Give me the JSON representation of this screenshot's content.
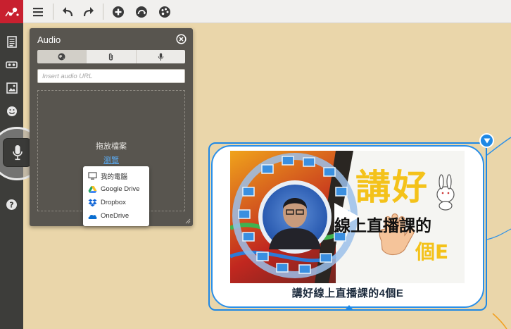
{
  "toolbar": {
    "logo": "mindomo-logo",
    "buttons": [
      {
        "name": "menu-button",
        "icon": "hamburger-icon"
      },
      {
        "name": "undo-button",
        "icon": "undo-icon"
      },
      {
        "name": "redo-button",
        "icon": "redo-icon"
      },
      {
        "name": "add-topic-button",
        "icon": "plus-circle-icon"
      },
      {
        "name": "relationship-button",
        "icon": "curve-arrow-icon"
      },
      {
        "name": "theme-button",
        "icon": "palette-icon"
      }
    ]
  },
  "sidebar": {
    "items": [
      {
        "name": "notes",
        "icon": "document-icon"
      },
      {
        "name": "link",
        "icon": "link-icon"
      },
      {
        "name": "image",
        "icon": "image-icon"
      },
      {
        "name": "icons",
        "icon": "smiley-icon"
      },
      {
        "name": "audio",
        "icon": "microphone-icon",
        "active": true
      },
      {
        "name": "help",
        "icon": "help-icon"
      }
    ]
  },
  "audio_panel": {
    "title": "Audio",
    "tabs": [
      "web",
      "attachment",
      "record"
    ],
    "active_tab": "web",
    "url_placeholder": "Insert audio URL",
    "drop_label": "拖放檔案",
    "browse_label": "瀏覽"
  },
  "source_menu": {
    "items": [
      {
        "label": "我的電腦",
        "icon": "computer-icon"
      },
      {
        "label": "Google Drive",
        "icon": "google-drive-icon"
      },
      {
        "label": "Dropbox",
        "icon": "dropbox-icon"
      },
      {
        "label": "OneDrive",
        "icon": "onedrive-icon"
      }
    ]
  },
  "topic_node": {
    "caption": "講好線上直播課的4個E",
    "thumbnail": {
      "line1": "講好",
      "line2": "線上直播課的",
      "line3": "個E"
    }
  },
  "colors": {
    "canvas": "#ead6aa",
    "brand": "#c8202f",
    "selection": "#1e88e5",
    "sidebar": "#3d3d3a",
    "panel": "#58554f"
  }
}
